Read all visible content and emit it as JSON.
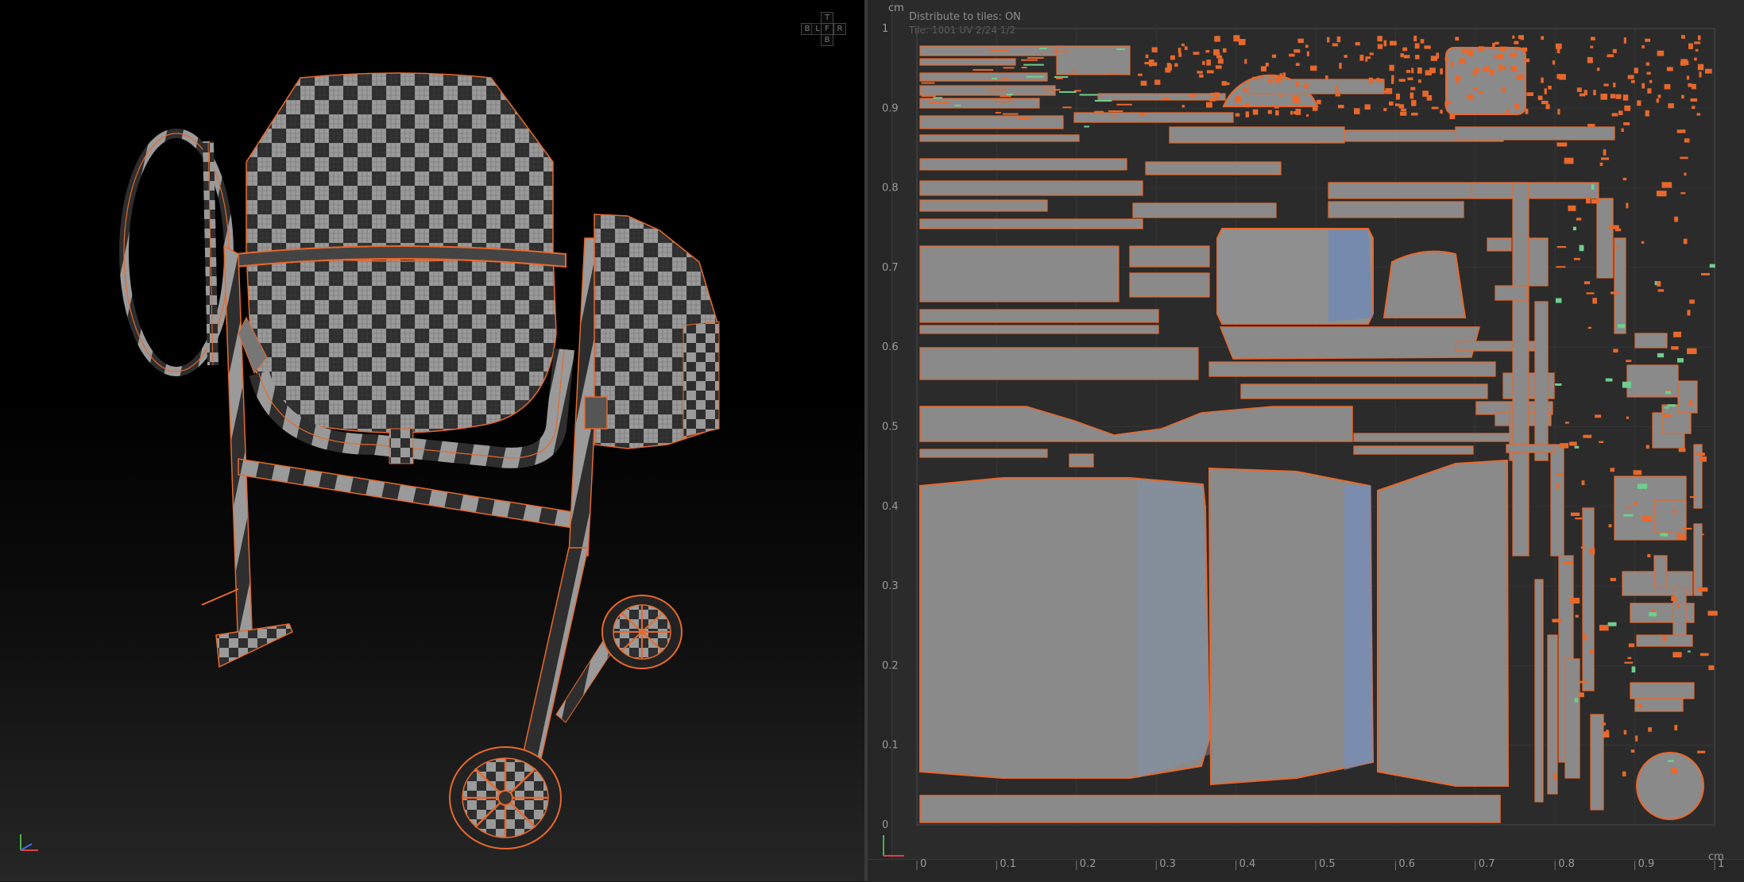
{
  "uv_editor": {
    "distribute_status": "Distribute to tiles: ON",
    "secondary_status": "Tile: 1001  UV  2/24  1/2",
    "unit_top": "cm",
    "unit_bottom": "cm",
    "v_ticks": [
      "1",
      "0.9",
      "0.8",
      "0.7",
      "0.6",
      "0.5",
      "0.4",
      "0.3",
      "0.2",
      "0.1",
      "0"
    ],
    "u_ticks": [
      "0",
      "0.1",
      "0.2",
      "0.3",
      "0.4",
      "0.5",
      "0.6",
      "0.7",
      "0.8",
      "0.9",
      "1"
    ]
  },
  "view_cube": {
    "top": "T",
    "back": "B",
    "left": "L",
    "front": "F",
    "right": "R",
    "bottom": "B"
  },
  "colors": {
    "accent_orange": "#e8682c",
    "uv_shell_gray": "#8a8a8a",
    "uv_background": "#2b2b2b",
    "uv_seam_green": "#6fcf8e",
    "stretch_blue": "#5c86c9"
  },
  "model": {
    "name_icon": "concrete-mixer-checker-model"
  }
}
